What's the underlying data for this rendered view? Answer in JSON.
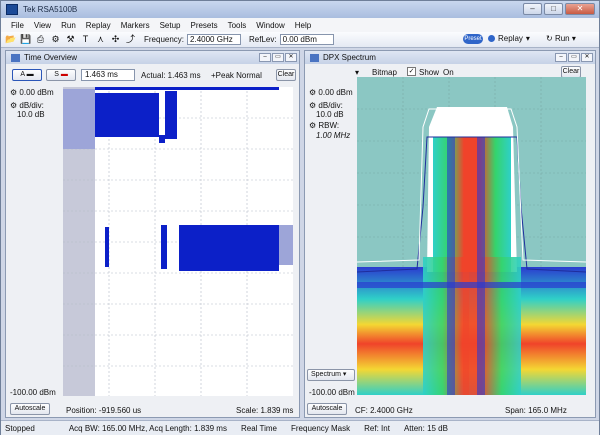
{
  "window": {
    "title": "Tek RSA5100B",
    "minimize": "–",
    "maximize": "□",
    "close": "✕"
  },
  "menu": [
    "File",
    "View",
    "Run",
    "Replay",
    "Markers",
    "Setup",
    "Presets",
    "Tools",
    "Window",
    "Help"
  ],
  "toolbar": {
    "frequency_label": "Frequency:",
    "frequency_value": "2.4000 GHz",
    "reflev_label": "RefLev:",
    "reflev_value": "0.00 dBm",
    "preset": "Preset",
    "replay": "Replay",
    "run": "Run"
  },
  "time_overview": {
    "title": "Time Overview",
    "btn_a": "A",
    "btn_s": "S",
    "time_field": "1.463 ms",
    "actual": "Actual: 1.463 ms",
    "mode": "+Peak Normal",
    "clear": "Clear",
    "ref": "0.00 dBm",
    "dbdiv_label": "dB/div:",
    "dbdiv_value": "10.0 dB",
    "bottom_ref": "-100.00 dBm",
    "autoscale": "Autoscale",
    "position": "Position: -919.560 us",
    "scale": "Scale: 1.839 ms"
  },
  "dpx_spectrum": {
    "title": "DPX Spectrum",
    "bitmap": "Bitmap",
    "show": "Show",
    "on": "On",
    "clear": "Clear",
    "ref": "0.00 dBm",
    "dbdiv_label": "dB/div:",
    "dbdiv_value": "10.0 dB",
    "rbw_label": "RBW:",
    "rbw_value": "1.00 MHz",
    "bottom_ref": "-100.00 dBm",
    "spectrum_select": "Spectrum",
    "autoscale": "Autoscale",
    "cf": "CF: 2.4000 GHz",
    "span": "Span: 165.0 MHz"
  },
  "status": {
    "state": "Stopped",
    "acq": "Acq BW: 165.00 MHz, Acq Length: 1.839 ms",
    "realtime": "Real Time",
    "freqmask": "Frequency Mask",
    "ref": "Ref: Int",
    "atten": "Atten: 15 dB"
  }
}
